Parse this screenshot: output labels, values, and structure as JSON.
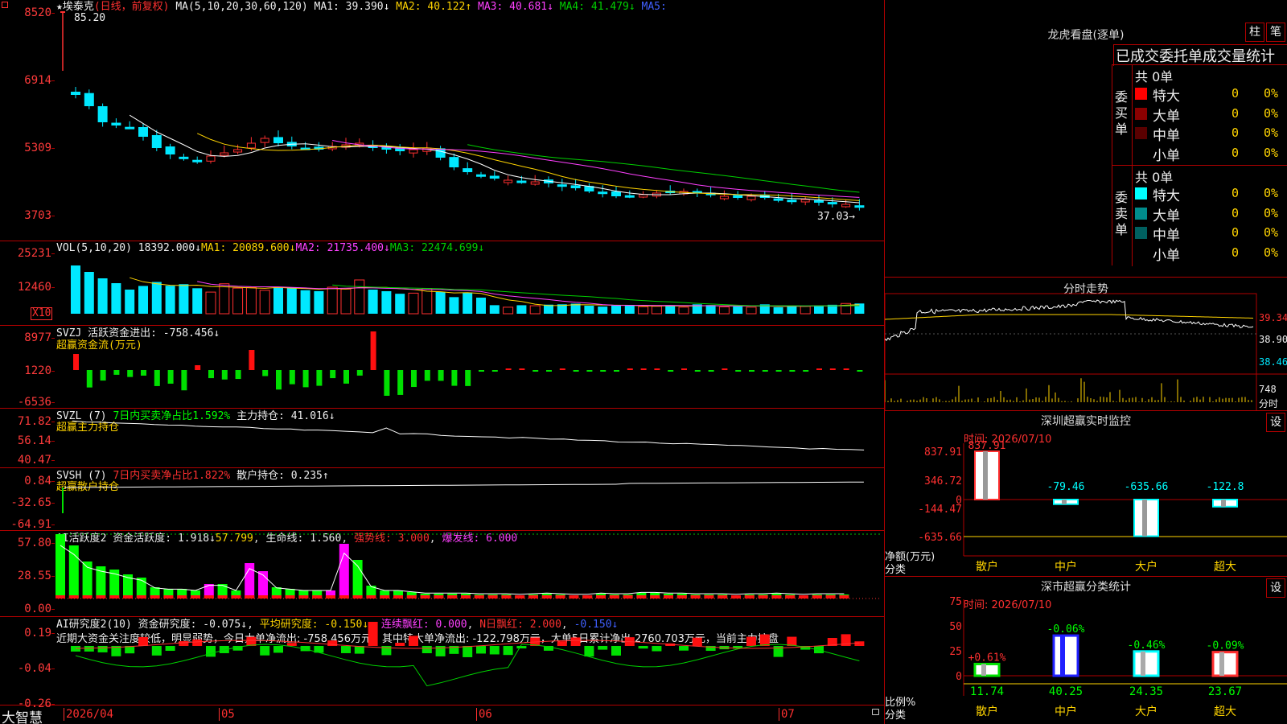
{
  "stock": {
    "name": "埃泰克",
    "mode": "(日线，前复权)",
    "max_price": "85.20",
    "min_price": "37.03→"
  },
  "ma": {
    "label": "MA(5,10,20,30,60,120)",
    "ma1": "MA1: 39.390↓",
    "ma2": "MA2: 40.122↑",
    "ma3": "MA3: 40.681↓",
    "ma4": "MA4: 41.479↓",
    "ma5": "MA5:"
  },
  "price_axis": [
    "8520",
    "6914",
    "5309",
    "3703"
  ],
  "vol": {
    "label": "VOL(5,10,20)",
    "v": "18392.000↓",
    "ma1": "MA1: 20089.600↓",
    "ma2": "MA2: 21735.400↓",
    "ma3": "MA3: 22474.699↓",
    "axis": [
      "25231",
      "12460"
    ],
    "unit": "X10"
  },
  "svzj": {
    "label": "SVZJ  活跃资金进出: -758.456↓",
    "sub": "超赢资金流(万元)",
    "axis": [
      "8977",
      "1220",
      "-6536"
    ]
  },
  "svzl": {
    "l1": "SVZL (7)",
    "l2": "7日内买卖净占比1.592%",
    "l3": "主力持仓: 41.016↓",
    "sub": "超赢主力持仓",
    "axis": [
      "71.82",
      "56.14",
      "40.47"
    ]
  },
  "svsh": {
    "l1": "SVSH (7)",
    "l2": "7日内买卖净占比1.822%",
    "l3": "散户持仓: 0.235↑",
    "sub": "超赢散户持仓",
    "axis": [
      "0.84",
      "-32.65",
      "-64.91"
    ]
  },
  "ai1": {
    "l1": "AI活跃度2 资金活跃度: 1.918↓",
    "l2": "57.799",
    "l3": "生命线: 1.560",
    "l4": "强势线: 3.000",
    "l5": "爆发线: 6.000",
    "axis": [
      "57.80",
      "28.55",
      "0.00"
    ]
  },
  "ai2": {
    "l1": "AI研究度2(10) 资金研究度: -0.075↓",
    "l2": "平均研究度: -0.150↓",
    "l3": "连续飘红: 0.000",
    "l4": "N日飘红: 2.000",
    "l5": "-0.150↓",
    "text": "近期大资金关注度较低，明显弱势，今日大单净流出: -758.456万元，其中特大单净流出: -122.798万元，大单5日累计净出-2760.703万元，当前主力控盘",
    "axis": [
      "0.19",
      "-0.04",
      "-0.26"
    ]
  },
  "dates": [
    "2026/04",
    "05",
    "06",
    "07"
  ],
  "footer": {
    "brand": "大智慧"
  },
  "lhb": {
    "title": "龙虎看盘(逐单)",
    "btn1": "柱",
    "btn2": "笔",
    "header": "已成交委托单成交量统计",
    "buy_label": "委买单",
    "sell_label": "委卖单",
    "total_buy": "共 0单",
    "total_sell": "共 0单",
    "buy": [
      {
        "name": "特大",
        "n": "0",
        "p": "0%",
        "color": "#ff0000"
      },
      {
        "name": "大单",
        "n": "0",
        "p": "0%",
        "color": "#8b0000"
      },
      {
        "name": "中单",
        "n": "0",
        "p": "0%",
        "color": "#5a0000"
      },
      {
        "name": "小单",
        "n": "0",
        "p": "0%",
        "color": "#000000"
      }
    ],
    "sell": [
      {
        "name": "特大",
        "n": "0",
        "p": "0%",
        "color": "#00ffff"
      },
      {
        "name": "大单",
        "n": "0",
        "p": "0%",
        "color": "#008b8b"
      },
      {
        "name": "中单",
        "n": "0",
        "p": "0%",
        "color": "#006060"
      },
      {
        "name": "小单",
        "n": "0",
        "p": "0%",
        "color": "#000000"
      }
    ]
  },
  "intraday": {
    "title": "分时走势",
    "axis": [
      "39.34",
      "38.90",
      "38.46"
    ],
    "vol_max": "748",
    "vol_unit": "分时"
  },
  "monitor": {
    "title": "深圳超赢实时监控",
    "btn": "设",
    "time": "时间: 2026/07/10",
    "axis": [
      "837.91",
      "346.72",
      "0",
      "-144.47",
      "-635.66"
    ],
    "unit": "净额(万元)",
    "cat_label": "分类",
    "bars": [
      {
        "name": "散户",
        "value": 837.91,
        "label": "837.91"
      },
      {
        "name": "中户",
        "value": -79.46,
        "label": "-79.46"
      },
      {
        "name": "大户",
        "value": -635.66,
        "label": "-635.66"
      },
      {
        "name": "超大",
        "value": -122.8,
        "label": "-122.8"
      }
    ]
  },
  "classify": {
    "title": "深市超赢分类统计",
    "btn": "设",
    "time": "时间: 2026/07/10",
    "axis": [
      "75",
      "50",
      "25",
      "0"
    ],
    "unit": "比例%",
    "cat_label": "分类",
    "bars": [
      {
        "name": "散户",
        "value": 11.74,
        "label": "11.74",
        "change": "+0.61%"
      },
      {
        "name": "中户",
        "value": 40.25,
        "label": "40.25",
        "change": "-0.06%"
      },
      {
        "name": "大户",
        "value": 24.35,
        "label": "24.35",
        "change": "-0.46%"
      },
      {
        "name": "超大",
        "value": 23.67,
        "label": "23.67",
        "change": "-0.09%"
      }
    ]
  }
}
